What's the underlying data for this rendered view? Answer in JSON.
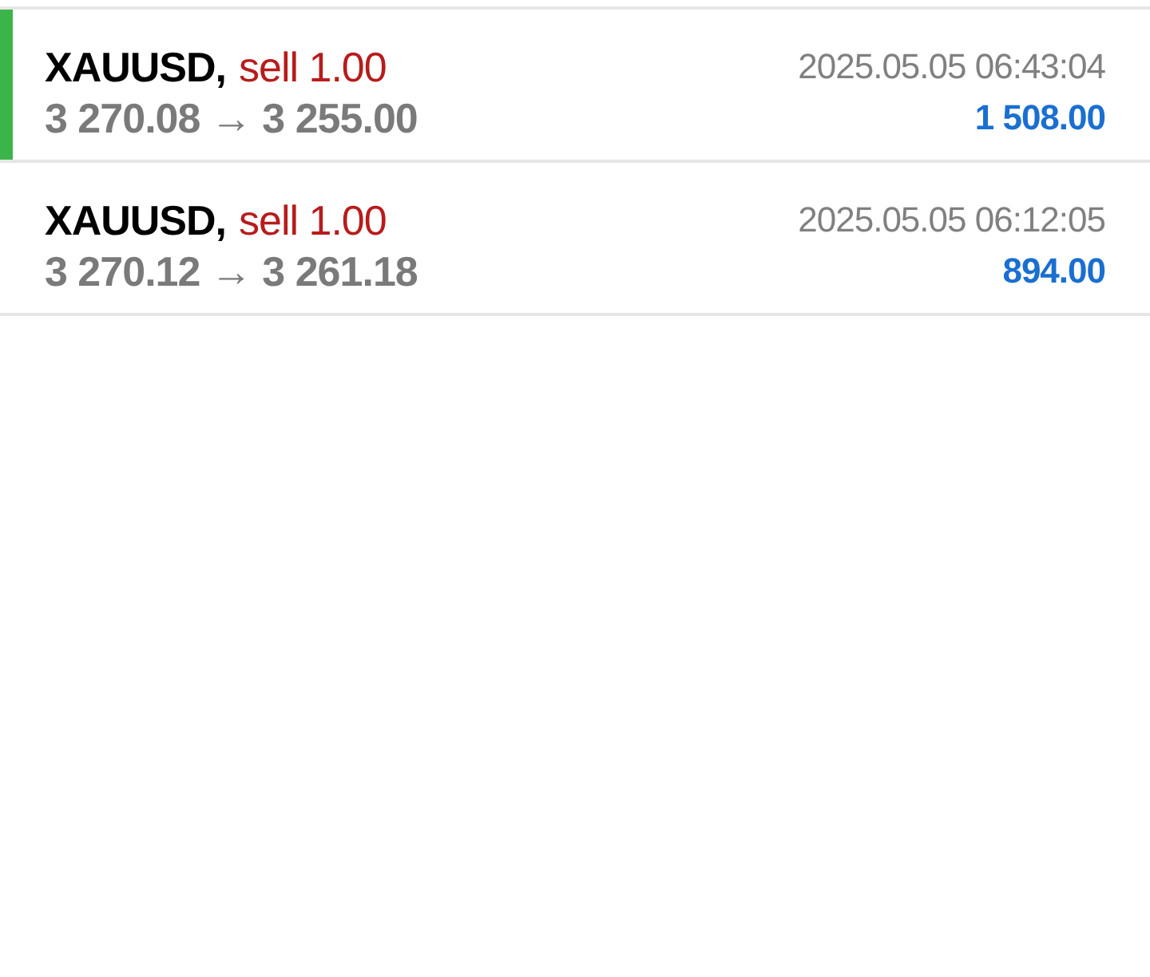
{
  "deals": [
    {
      "symbol": "XAUUSD,",
      "order": "sell 1.00",
      "prices": "3 270.08 → 3 255.00",
      "time": "2025.05.05 06:43:04",
      "profit": "1 508.00",
      "selected": true
    },
    {
      "symbol": "XAUUSD,",
      "order": "sell 1.00",
      "prices": "3 270.12 → 3 261.18",
      "time": "2025.05.05 06:12:05",
      "profit": "894.00",
      "selected": false
    }
  ]
}
